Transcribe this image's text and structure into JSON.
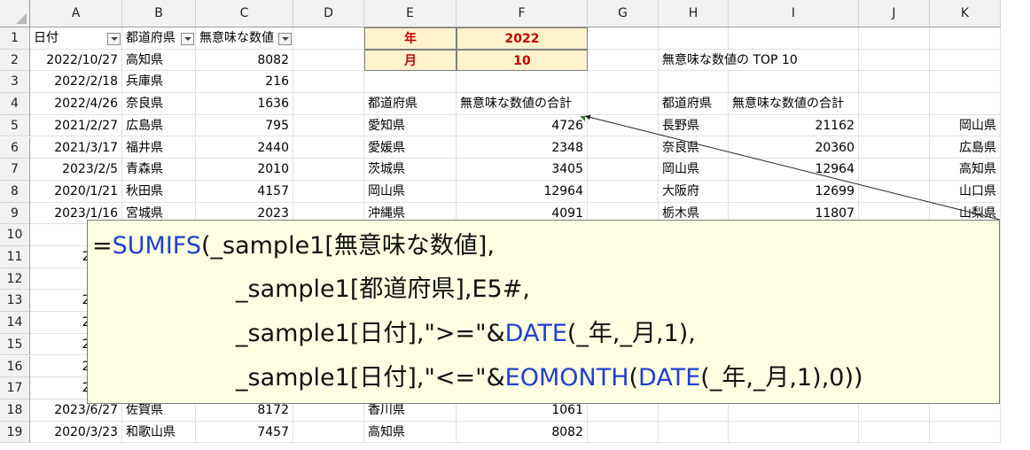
{
  "columns": [
    "A",
    "B",
    "C",
    "D",
    "E",
    "F",
    "G",
    "H",
    "I",
    "J",
    "K"
  ],
  "rows": [
    "1",
    "2",
    "3",
    "4",
    "5",
    "6",
    "7",
    "8",
    "9",
    "10",
    "11",
    "12",
    "13",
    "14",
    "15",
    "16",
    "17",
    "18",
    "19"
  ],
  "header_row": {
    "a1": "日付",
    "b1": "都道府県",
    "c1": "無意味な数値"
  },
  "year_month": {
    "year_label": "年",
    "year_value": "2022",
    "month_label": "月",
    "month_value": "10"
  },
  "top10_title": "無意味な数値の TOP 10",
  "summary_headers": {
    "e4": "都道府県",
    "f4": "無意味な数値の合計",
    "h4": "都道府県",
    "i4": "無意味な数値の合計"
  },
  "table_rows": [
    {
      "date": "2022/10/27",
      "pref": "高知県",
      "value": "8082"
    },
    {
      "date": "2022/2/18",
      "pref": "兵庫県",
      "value": "216"
    },
    {
      "date": "2022/4/26",
      "pref": "奈良県",
      "value": "1636"
    },
    {
      "date": "2021/2/27",
      "pref": "広島県",
      "value": "795"
    },
    {
      "date": "2021/3/17",
      "pref": "福井県",
      "value": "2440"
    },
    {
      "date": "2023/2/5",
      "pref": "青森県",
      "value": "2010"
    },
    {
      "date": "2020/1/21",
      "pref": "秋田県",
      "value": "4157"
    },
    {
      "date": "2023/1/16",
      "pref": "宮城県",
      "value": "2023"
    },
    {
      "date": "2023",
      "pref": "",
      "value": ""
    },
    {
      "date": "2022/",
      "pref": "",
      "value": ""
    },
    {
      "date": "2020",
      "pref": "",
      "value": ""
    },
    {
      "date": "2021/",
      "pref": "",
      "value": ""
    },
    {
      "date": "2023/",
      "pref": "",
      "value": ""
    },
    {
      "date": "2023/",
      "pref": "",
      "value": ""
    },
    {
      "date": "2021/",
      "pref": "",
      "value": ""
    },
    {
      "date": "2023/",
      "pref": "",
      "value": ""
    },
    {
      "date": "2023/6/27",
      "pref": "佐賀県",
      "value": "8172"
    },
    {
      "date": "2020/3/23",
      "pref": "和歌山県",
      "value": "7457"
    }
  ],
  "sum_rows": [
    {
      "pref": "愛知県",
      "total": "4726"
    },
    {
      "pref": "愛媛県",
      "total": "2348"
    },
    {
      "pref": "茨城県",
      "total": "3405"
    },
    {
      "pref": "岡山県",
      "total": "12964"
    },
    {
      "pref": "沖縄県",
      "total": "4091"
    },
    {
      "pref": "",
      "total": ""
    },
    {
      "pref": "",
      "total": ""
    },
    {
      "pref": "",
      "total": ""
    },
    {
      "pref": "",
      "total": ""
    },
    {
      "pref": "",
      "total": ""
    },
    {
      "pref": "",
      "total": ""
    },
    {
      "pref": "",
      "total": ""
    },
    {
      "pref": "",
      "total": ""
    },
    {
      "pref": "香川県",
      "total": "1061"
    },
    {
      "pref": "高知県",
      "total": "8082"
    }
  ],
  "top_rows": [
    {
      "pref": "長野県",
      "total": "21162"
    },
    {
      "pref": "奈良県",
      "total": "20360"
    },
    {
      "pref": "岡山県",
      "total": "12964"
    },
    {
      "pref": "大阪府",
      "total": "12699"
    },
    {
      "pref": "栃木県",
      "total": "11807"
    }
  ],
  "k_rows": [
    "岡山県",
    "広島県",
    "高知県",
    "山口県",
    "山梨県"
  ],
  "formula_lines": [
    [
      {
        "t": "=",
        "f": false
      },
      {
        "t": "SUMIFS",
        "f": true
      },
      {
        "t": "(_sample1[無意味な数値],",
        "f": false
      }
    ],
    [
      {
        "t": "_sample1[都道府県],E5#,",
        "f": false
      }
    ],
    [
      {
        "t": "_sample1[日付],\">=\"&",
        "f": false
      },
      {
        "t": "DATE",
        "f": true
      },
      {
        "t": "(_年,_月,1),",
        "f": false
      }
    ],
    [
      {
        "t": "_sample1[日付],\"<=\"&",
        "f": false
      },
      {
        "t": "EOMONTH",
        "f": true
      },
      {
        "t": "(",
        "f": false
      },
      {
        "t": "DATE",
        "f": true
      },
      {
        "t": "(_年,_月,1),0))",
        "f": false
      }
    ]
  ],
  "colors": {
    "function": "#1f3fd0",
    "year_month_fill": "#fff2cc",
    "year_month_text": "#c00000",
    "tooltip_fill": "#ffffe1"
  }
}
